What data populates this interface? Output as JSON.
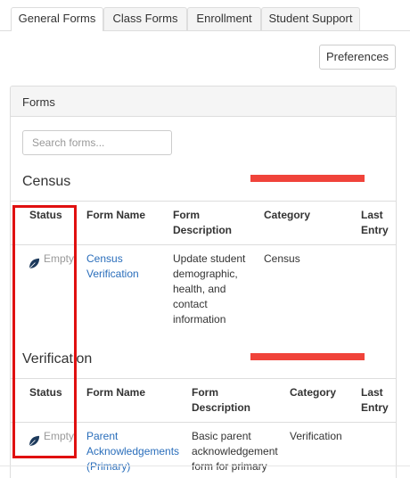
{
  "tabs": [
    {
      "label": "General Forms"
    },
    {
      "label": "Class Forms"
    },
    {
      "label": "Enrollment"
    },
    {
      "label": "Student Support"
    }
  ],
  "toolbar": {
    "preferences_label": "Preferences"
  },
  "panel": {
    "title": "Forms",
    "search_placeholder": "Search forms..."
  },
  "table_headers": {
    "status": "Status",
    "form_name": "Form Name",
    "form_desc_1": "Form",
    "form_desc_2": "Description",
    "category": "Category",
    "last_1": "Last",
    "last_2": "Entry"
  },
  "sections": [
    {
      "title": "Census",
      "rows": [
        {
          "status": "Empty",
          "name_lines": [
            "Census",
            "Verification"
          ],
          "desc_lines": [
            "Update student",
            "demographic,",
            "health, and",
            "contact",
            "information"
          ],
          "category": "Census",
          "last_entry": ""
        }
      ]
    },
    {
      "title": "Verification",
      "rows": [
        {
          "status": "Empty",
          "name_lines": [
            "Parent",
            "Acknowledgements",
            "(Primary)"
          ],
          "desc_lines": [
            "Basic parent",
            "acknowledgement",
            "form for primary"
          ],
          "category": "Verification",
          "last_entry": ""
        }
      ]
    }
  ],
  "colors": {
    "highlight_box": "#e01010",
    "redaction_bar": "#f0433a",
    "link": "#2a6ebb",
    "leaf": "#1d3a5c"
  },
  "icons": {
    "status": "leaf-icon"
  }
}
